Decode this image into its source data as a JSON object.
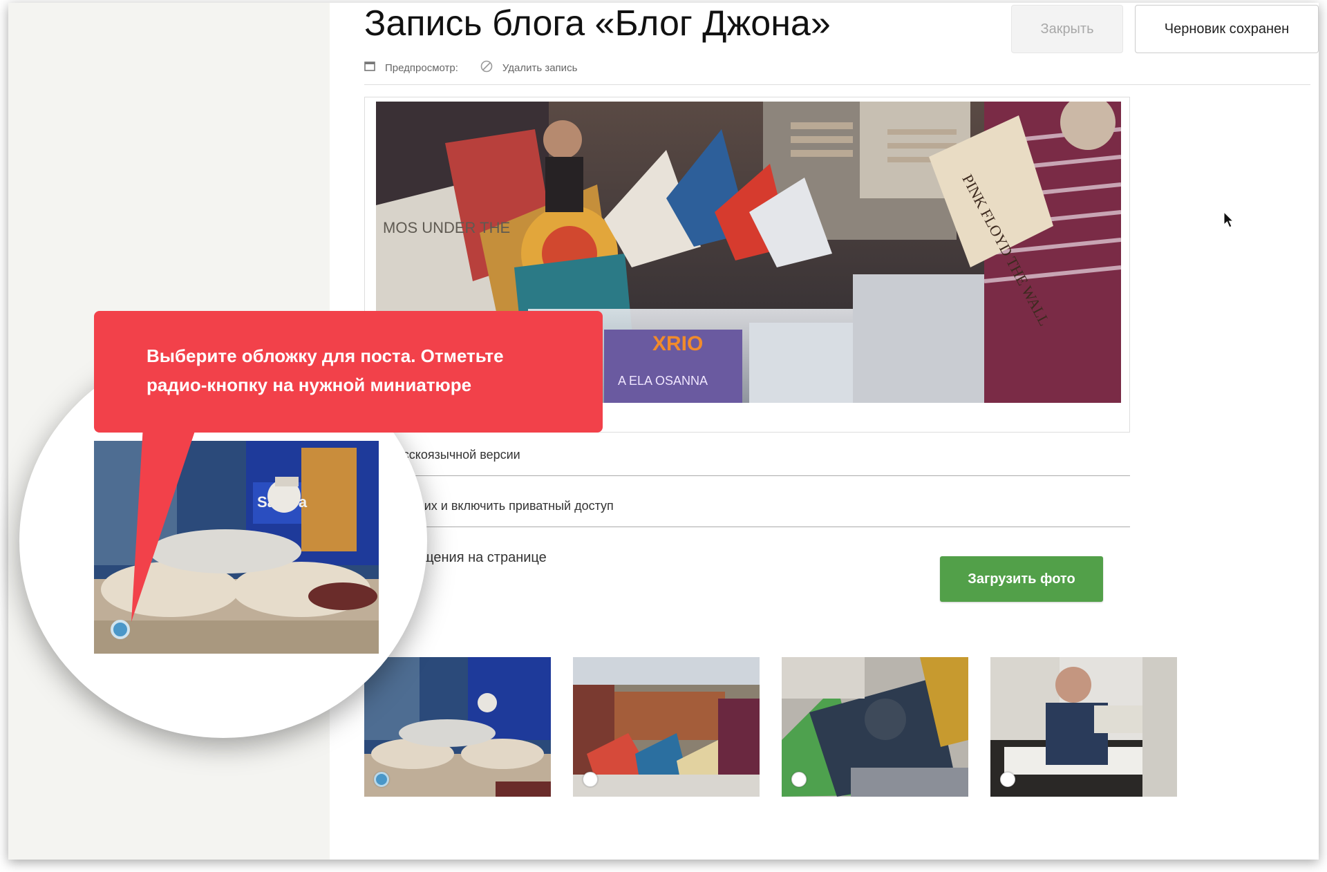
{
  "header": {
    "title": "Запись блога «Блог Джона»",
    "preview_label": "Предпросмотр:",
    "delete_label": "Удалить запись",
    "close_button": "Закрыть",
    "draft_button": "Черновик сохранен"
  },
  "options": {
    "row1": "ть в русскоязычной версии",
    "row2": "посторонних и включить приватный доступ",
    "row3": "ля размещения на странице"
  },
  "upload_button": "Загрузить фото",
  "thumbnails": [
    {
      "selected": true
    },
    {
      "selected": false
    },
    {
      "selected": false
    },
    {
      "selected": false
    }
  ],
  "hero_text": {
    "album1": "MOS  UNDER THE",
    "album2": "PINK FLOYD THE WALL",
    "album3": "XRIO",
    "album4": "A ELA OSANNA"
  },
  "magnifier_text": {
    "album": "Samba"
  },
  "callout": {
    "line1": "Выберите обложку для поста. Отметьте",
    "line2": "радио-кнопку на нужной миниатюре"
  },
  "colors": {
    "callout": "#f2414a",
    "upload_button": "#52a049",
    "radio_selected": "#4a97c8",
    "sidebar": "#f4f4f1"
  },
  "icons": [
    "preview-icon",
    "delete-icon",
    "cursor-icon"
  ]
}
